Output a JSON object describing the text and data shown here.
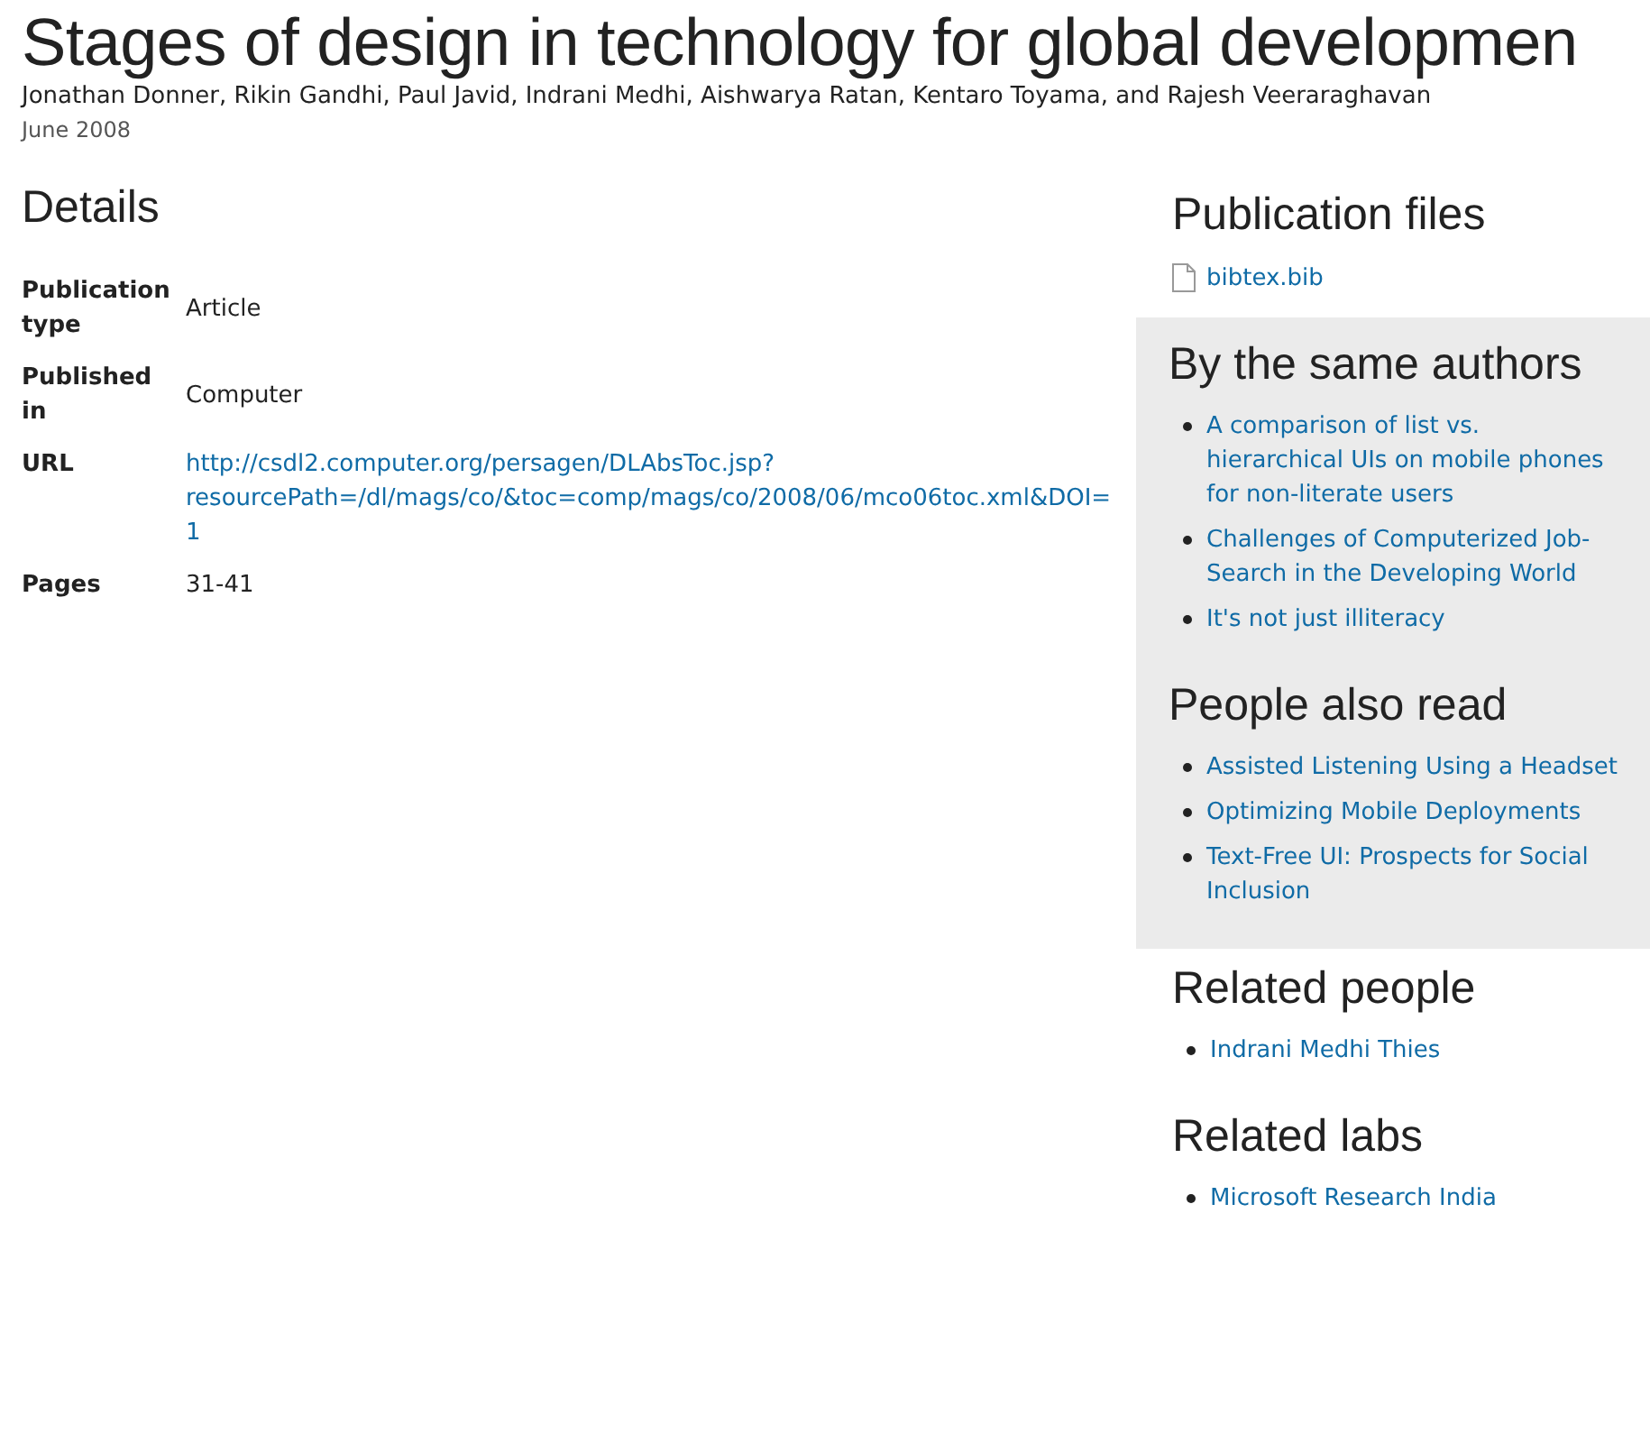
{
  "title": "Stages of design in technology for global developmen",
  "authors": "Jonathan Donner, Rikin Gandhi, Paul Javid, Indrani Medhi, Aishwarya Ratan, Kentaro Toyama, and Rajesh Veeraraghavan",
  "date": "June 2008",
  "details": {
    "heading": "Details",
    "rows": [
      {
        "label": "Publication type",
        "value": "Article",
        "kind": "text"
      },
      {
        "label": "Published in",
        "value": "Computer",
        "kind": "text"
      },
      {
        "label": "URL",
        "value": "http://csdl2.computer.org/persagen/DLAbsToc.jsp?resourcePath=/dl/mags/co/&toc=comp/mags/co/2008/06/mco06toc.xml&DOI=1",
        "kind": "link"
      },
      {
        "label": "Pages",
        "value": "31-41",
        "kind": "text"
      }
    ]
  },
  "publication_files": {
    "heading": "Publication files",
    "items": [
      "bibtex.bib"
    ]
  },
  "shaded_panel": [
    {
      "heading": "By the same authors",
      "items": [
        "A comparison of list vs. hierarchical UIs on mobile phones for non-literate users",
        "Challenges of Computerized Job-Search in the Developing World",
        "It's not just illiteracy"
      ]
    },
    {
      "heading": "People also read",
      "items": [
        "Assisted Listening Using a Headset",
        "Optimizing Mobile Deployments",
        "Text-Free UI: Prospects for Social Inclusion"
      ]
    }
  ],
  "related": [
    {
      "heading": "Related people",
      "items": [
        "Indrani Medhi Thies"
      ]
    },
    {
      "heading": "Related labs",
      "items": [
        "Microsoft Research India"
      ]
    }
  ]
}
